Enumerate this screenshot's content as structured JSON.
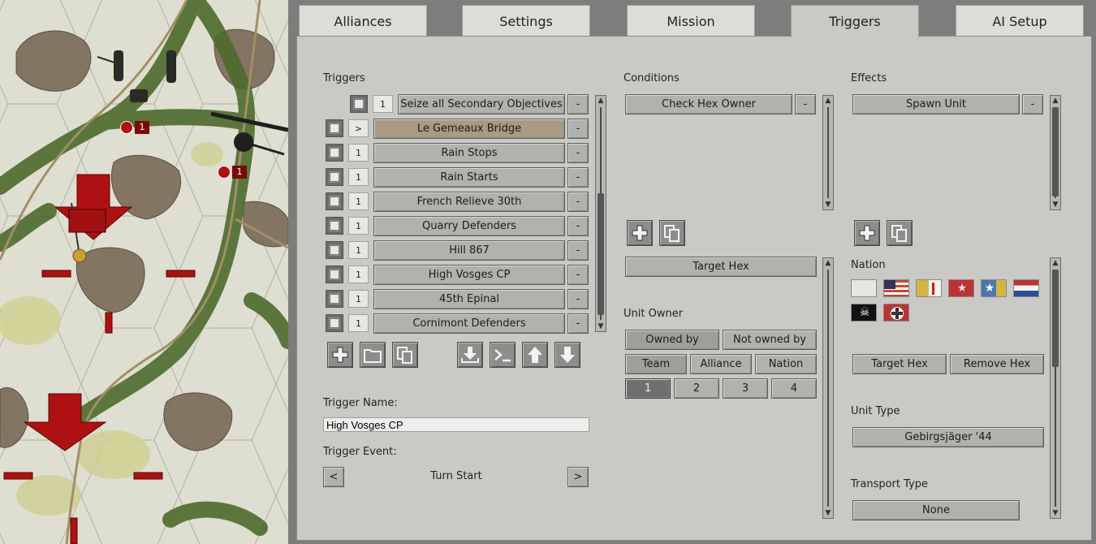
{
  "tabs": [
    "Alliances",
    "Settings",
    "Mission",
    "Triggers",
    "AI Setup"
  ],
  "active_tab": "Triggers",
  "map": {
    "markers": [
      "1",
      "1"
    ]
  },
  "triggers": {
    "heading": "Triggers",
    "rows": [
      {
        "count": "1",
        "name": "Seize all Secondary Objectives"
      },
      {
        "count": ">",
        "name": "Le Gemeaux Bridge"
      },
      {
        "count": "1",
        "name": "Rain Stops"
      },
      {
        "count": "1",
        "name": "Rain Starts"
      },
      {
        "count": "1",
        "name": "French Relieve 30th"
      },
      {
        "count": "1",
        "name": "Quarry Defenders"
      },
      {
        "count": "1",
        "name": "Hill 867"
      },
      {
        "count": "1",
        "name": "High Vosges CP"
      },
      {
        "count": "1",
        "name": "45th Epinal"
      },
      {
        "count": "1",
        "name": "Cornimont Defenders"
      }
    ],
    "remove_label": "-",
    "name_label": "Trigger Name:",
    "name_value": "High Vosges CP",
    "event_label": "Trigger Event:",
    "event_value": "Turn Start",
    "prev": "<",
    "next": ">"
  },
  "conditions": {
    "heading": "Conditions",
    "item": "Check Hex Owner",
    "remove_label": "-",
    "target_hex": "Target Hex",
    "unit_owner_label": "Unit Owner",
    "owned_by": "Owned by",
    "not_owned_by": "Not owned by",
    "team": "Team",
    "alliance": "Alliance",
    "nation": "Nation",
    "numbers": [
      "1",
      "2",
      "3",
      "4"
    ]
  },
  "effects": {
    "heading": "Effects",
    "item": "Spawn Unit",
    "remove_label": "-",
    "nation_label": "Nation",
    "flags": [
      "neutral-flag-icon",
      "usa-flag-icon",
      "vatican-flag-icon",
      "star-flag-icon",
      "un-flag-icon",
      "dutch-flag-icon",
      "skull-flag-icon",
      "cross-flag-icon"
    ],
    "target_hex": "Target Hex",
    "remove_hex": "Remove Hex",
    "unit_type_label": "Unit Type",
    "unit_type_value": "Gebirgsjäger '44",
    "transport_label": "Transport Type",
    "transport_value": "None"
  },
  "colors": {
    "panel": "#c9c9c6",
    "button": "#b1b1ae",
    "selected_row": "#a99a80",
    "map_forest": "#4c6b2a",
    "objective_red": "#b01010"
  }
}
